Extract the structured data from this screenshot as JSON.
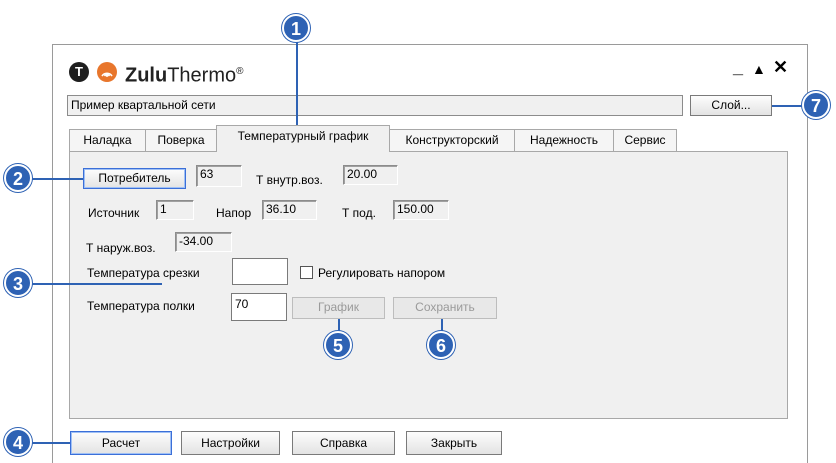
{
  "app": {
    "brand_bold": "Zulu",
    "brand_light": "Thermo",
    "brand_mark": "®",
    "logo_letter": "T"
  },
  "window_controls": {
    "minimize": "_",
    "maximize": "▲",
    "close": "✕"
  },
  "network_name": "Пример квартальной сети",
  "layer_button": "Слой...",
  "tabs": [
    {
      "label": "Наладка"
    },
    {
      "label": "Поверка"
    },
    {
      "label": "Температурный график",
      "active": true
    },
    {
      "label": "Конструкторский"
    },
    {
      "label": "Надежность"
    },
    {
      "label": "Сервис"
    }
  ],
  "panel": {
    "consumer_button": "Потребитель",
    "consumer_value": "63",
    "t_inner_label": "Т внутр.воз.",
    "t_inner_value": "20.00",
    "source_label": "Источник",
    "source_value": "1",
    "head_label": "Напор",
    "head_value": "36.10",
    "t_supply_label": "Т под.",
    "t_supply_value": "150.00",
    "t_outer_label": "Т наруж.воз.",
    "t_outer_value": "-34.00",
    "cut_temp_label": "Температура срезки",
    "cut_temp_value": "",
    "regulate_label": "Регулировать напором",
    "regulate_checked": false,
    "shelf_temp_label": "Температура полки",
    "shelf_temp_value": "70",
    "chart_button": "График",
    "save_button": "Сохранить"
  },
  "footer": {
    "calc": "Расчет",
    "settings": "Настройки",
    "help": "Справка",
    "close": "Закрыть"
  },
  "callouts": [
    "1",
    "2",
    "3",
    "4",
    "5",
    "6",
    "7"
  ],
  "colors": {
    "callout": "#2e62b4",
    "logo_orange": "#e8762c",
    "logo_dark": "#1e1e1e"
  }
}
